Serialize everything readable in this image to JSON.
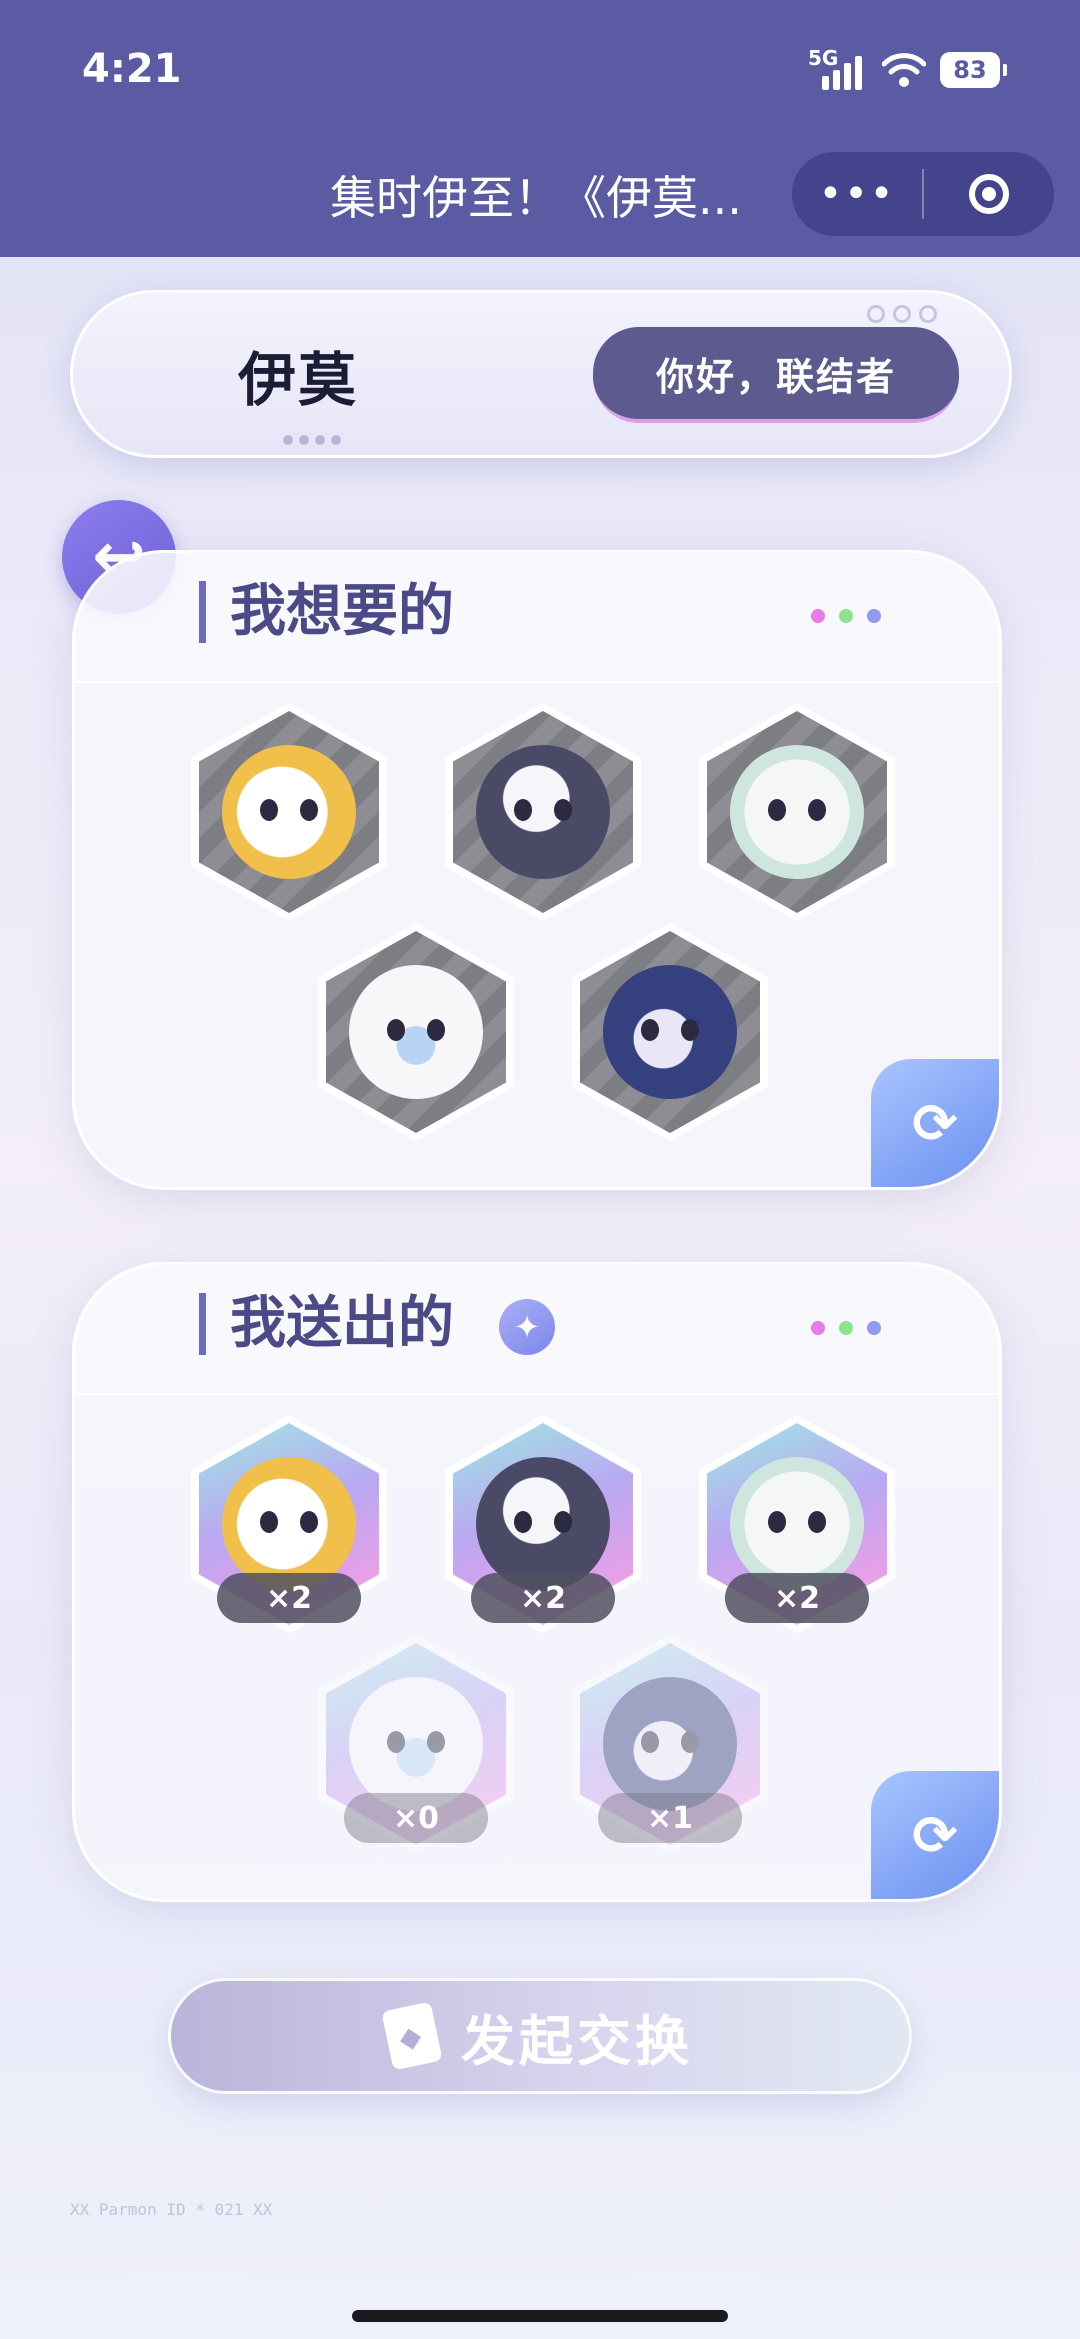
{
  "status": {
    "time": "4:21",
    "network": "5G",
    "battery": "83"
  },
  "nav": {
    "title": "集时伊至！《伊莫...",
    "more_label": "•••"
  },
  "header": {
    "logo_text": "伊莫",
    "greeting_button": "你好，联结者"
  },
  "wanted": {
    "title": "我想要的",
    "pets": [
      "gold",
      "dark",
      "sheep",
      "bear",
      "blue"
    ]
  },
  "offered": {
    "title": "我送出的",
    "counts": [
      "×2",
      "×2",
      "×2",
      "×0",
      "×1"
    ]
  },
  "action": {
    "launch_label": "发起交换"
  },
  "colors": {
    "header_bg": "#5b5ba4",
    "dot_pink": "#e67ce8",
    "dot_green": "#8ee38f",
    "dot_blue": "#8f9bf0",
    "accent": "#6b6bc2"
  },
  "footer": {
    "fine_print": "XX Parmon ID * 021 XX"
  }
}
